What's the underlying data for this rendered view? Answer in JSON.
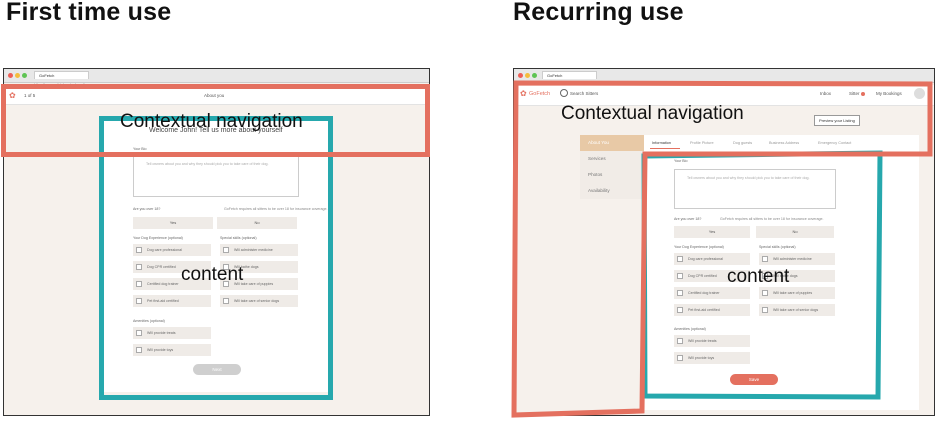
{
  "left": {
    "heading": "First time use",
    "browser_tab": "GoFetch",
    "url": "https://www.gofetch.co/onboarding",
    "step": "1 of 5",
    "nav_title": "About you",
    "welcome": "Welcome John! Tell us more about yourself",
    "bio_label": "Your Bio",
    "bio_placeholder": "Tell owners about you and why they should pick you to take care of their dog.",
    "age_question": "Are you over 18?",
    "age_note": "GoFetch requires all sitters to be over 18 for insurance coverage.",
    "yes": "Yes",
    "no": "No",
    "experience_label": "Your Dog Experience (optional)",
    "skills_label": "Special skills (optional)",
    "experience": [
      "Dog care professional",
      "Dog CPR certified",
      "Certified dog trainer",
      "Pet first-aid certified"
    ],
    "skills": [
      "Will administer medicine",
      "Will bathe dogs",
      "Will take care of puppies",
      "Will take care of senior dogs"
    ],
    "amenities_label": "Amenities (optional)",
    "amenities": [
      "Will provide treats",
      "Will provide toys"
    ],
    "next": "Next",
    "nav_overlay_label": "Contextual navigation",
    "content_overlay_label": "content"
  },
  "right": {
    "heading": "Recurring use",
    "browser_tab": "GoFetch",
    "brand": "GoFetch",
    "search": "Search Sitters",
    "nav_links": [
      "Inbox",
      "Sitter",
      "My Bookings"
    ],
    "preview": "Preview your Listing",
    "sidebar": [
      "About You",
      "Services",
      "Photos",
      "Availability"
    ],
    "tabs": [
      "Information",
      "Profile Picture",
      "Dog guests",
      "Business Address",
      "Emergency Contact"
    ],
    "bio_label": "Your Bio",
    "bio_placeholder": "Tell owners about you and why they should pick you to take care of their dog.",
    "age_question": "Are you over 18?",
    "age_note": "GoFetch requires all sitters to be over 18 for insurance coverage.",
    "yes": "Yes",
    "no": "No",
    "experience_label": "Your Dog Experience (optional)",
    "skills_label": "Special skills (optional)",
    "experience": [
      "Dog care professional",
      "Dog CPR certified",
      "Certified dog trainer",
      "Pet first-aid certified"
    ],
    "skills": [
      "Will administer medicine",
      "Will bathe dogs",
      "Will take care of puppies",
      "Will take care of senior dogs"
    ],
    "amenities_label": "Amenities (optional)",
    "amenities": [
      "Will provide treats",
      "Will provide toys"
    ],
    "save": "Save",
    "nav_overlay_label": "Contextual navigation",
    "content_overlay_label": "content"
  },
  "colors": {
    "red_overlay": "#e4705f",
    "teal_overlay": "#26a8ad",
    "brand": "#e4705f"
  }
}
